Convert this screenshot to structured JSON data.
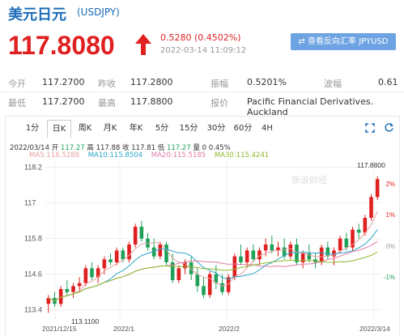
{
  "header": {
    "title": "美元日元",
    "code": "(USDJPY)"
  },
  "quote": {
    "price": "117.8080",
    "change": "0.5280 (0.4502%)",
    "time": "2022-03-14  11:09:12",
    "reverse_label": "⇄ 查看反向汇率 JPYUSD"
  },
  "stats": {
    "row1": [
      {
        "label": "今开",
        "value": "117.2700"
      },
      {
        "label": "昨收",
        "value": "117.2800"
      },
      {
        "label": "振幅",
        "value": "0.5201%"
      },
      {
        "label": "波幅",
        "value": "0.61"
      }
    ],
    "row2": [
      {
        "label": "最低",
        "value": "117.2700"
      },
      {
        "label": "最高",
        "value": "117.8800"
      },
      {
        "label": "报价",
        "value": "Pacific Financial Derivatives. Auckland"
      }
    ]
  },
  "tabs": [
    "1分",
    "日K",
    "周K",
    "月K",
    "年K",
    "5分",
    "15分",
    "30分",
    "60分",
    "4H"
  ],
  "active_tab": "日K",
  "toolbar_icons": [
    "fullscreen-icon",
    "refresh-icon"
  ],
  "ohlc": {
    "date": "2022/03/14",
    "open_label": "开",
    "open": "117.27",
    "high_label": "高",
    "high": "117.88",
    "close_label": "收",
    "close": "117.81",
    "low_label": "低",
    "low": "117.27",
    "vol_label": "量",
    "vol": "0",
    "pct": "0.45%"
  },
  "ma": [
    {
      "label": "MA5:",
      "value": "116.5288",
      "color": "#e8a0a0"
    },
    {
      "label": "MA10:",
      "value": "115.8504",
      "color": "#2aa7c9"
    },
    {
      "label": "MA20:",
      "value": "115.5185",
      "color": "#e07aa8"
    },
    {
      "label": "MA30:",
      "value": "115.4241",
      "color": "#8db82a"
    }
  ],
  "colors": {
    "up": "#e02020",
    "down": "#1fa15a",
    "accent": "#1a6bb8"
  },
  "chart_data": {
    "type": "candlestick",
    "ylim": [
      113.2,
      118.3
    ],
    "yticks": [
      "118.2",
      "117",
      "115.8",
      "114.6",
      "113.4"
    ],
    "pct_ticks": [
      "2%",
      "1%",
      "0%",
      "-1%"
    ],
    "x_labels": [
      "2021/12/15",
      "2022/1",
      "2022/2",
      "2022/3/14"
    ],
    "max_label": "117.8800",
    "min_label": "113.1100",
    "watermark": "新浪财经",
    "candles": [
      [
        113.6,
        113.9,
        113.3,
        113.8
      ],
      [
        113.8,
        114.0,
        113.5,
        113.6
      ],
      [
        113.6,
        114.2,
        113.5,
        114.1
      ],
      [
        114.1,
        114.4,
        113.9,
        114.0
      ],
      [
        114.0,
        114.3,
        113.8,
        114.2
      ],
      [
        114.2,
        114.5,
        114.0,
        114.3
      ],
      [
        114.3,
        114.9,
        114.2,
        114.8
      ],
      [
        114.8,
        115.0,
        114.4,
        114.5
      ],
      [
        114.5,
        114.9,
        114.3,
        114.8
      ],
      [
        114.8,
        115.2,
        114.6,
        115.1
      ],
      [
        115.1,
        115.3,
        114.9,
        115.0
      ],
      [
        115.0,
        115.5,
        114.9,
        115.4
      ],
      [
        115.4,
        115.5,
        115.0,
        115.1
      ],
      [
        115.1,
        115.7,
        115.0,
        115.6
      ],
      [
        115.6,
        116.3,
        115.5,
        116.2
      ],
      [
        116.2,
        116.4,
        115.7,
        115.8
      ],
      [
        115.8,
        116.0,
        115.4,
        115.5
      ],
      [
        115.5,
        115.8,
        115.1,
        115.2
      ],
      [
        115.2,
        115.7,
        115.1,
        115.6
      ],
      [
        115.6,
        115.7,
        114.9,
        115.0
      ],
      [
        115.0,
        115.3,
        114.3,
        114.4
      ],
      [
        114.4,
        114.9,
        114.3,
        114.8
      ],
      [
        114.8,
        115.1,
        114.6,
        115.0
      ],
      [
        115.0,
        115.2,
        114.4,
        114.6
      ],
      [
        114.6,
        114.8,
        114.0,
        114.2
      ],
      [
        114.2,
        114.5,
        113.8,
        113.9
      ],
      [
        113.9,
        114.7,
        113.8,
        114.6
      ],
      [
        114.6,
        114.9,
        114.1,
        114.3
      ],
      [
        114.3,
        114.6,
        113.9,
        114.0
      ],
      [
        114.0,
        114.6,
        113.9,
        114.5
      ],
      [
        114.5,
        115.3,
        114.4,
        115.2
      ],
      [
        115.2,
        115.6,
        114.9,
        115.0
      ],
      [
        115.0,
        115.5,
        114.8,
        115.4
      ],
      [
        115.4,
        115.6,
        115.0,
        115.1
      ],
      [
        115.1,
        115.5,
        114.9,
        115.4
      ],
      [
        115.4,
        115.8,
        115.2,
        115.6
      ],
      [
        115.6,
        115.9,
        115.3,
        115.4
      ],
      [
        115.4,
        115.7,
        115.2,
        115.5
      ],
      [
        115.5,
        115.8,
        115.1,
        115.2
      ],
      [
        115.2,
        115.7,
        115.1,
        115.6
      ],
      [
        115.6,
        115.8,
        114.9,
        115.0
      ],
      [
        115.0,
        115.4,
        114.8,
        115.3
      ],
      [
        115.3,
        115.6,
        115.0,
        115.1
      ],
      [
        115.1,
        115.3,
        114.8,
        115.0
      ],
      [
        115.0,
        115.6,
        114.9,
        115.5
      ],
      [
        115.5,
        115.7,
        115.1,
        115.2
      ],
      [
        115.2,
        115.5,
        114.9,
        115.4
      ],
      [
        115.4,
        115.9,
        115.3,
        115.8
      ],
      [
        115.8,
        116.0,
        115.4,
        115.5
      ],
      [
        115.5,
        116.2,
        115.4,
        116.1
      ],
      [
        116.1,
        116.3,
        115.8,
        116.0
      ],
      [
        116.0,
        116.6,
        115.9,
        116.5
      ],
      [
        116.5,
        117.3,
        116.4,
        117.2
      ],
      [
        117.2,
        117.9,
        117.1,
        117.8
      ]
    ]
  }
}
